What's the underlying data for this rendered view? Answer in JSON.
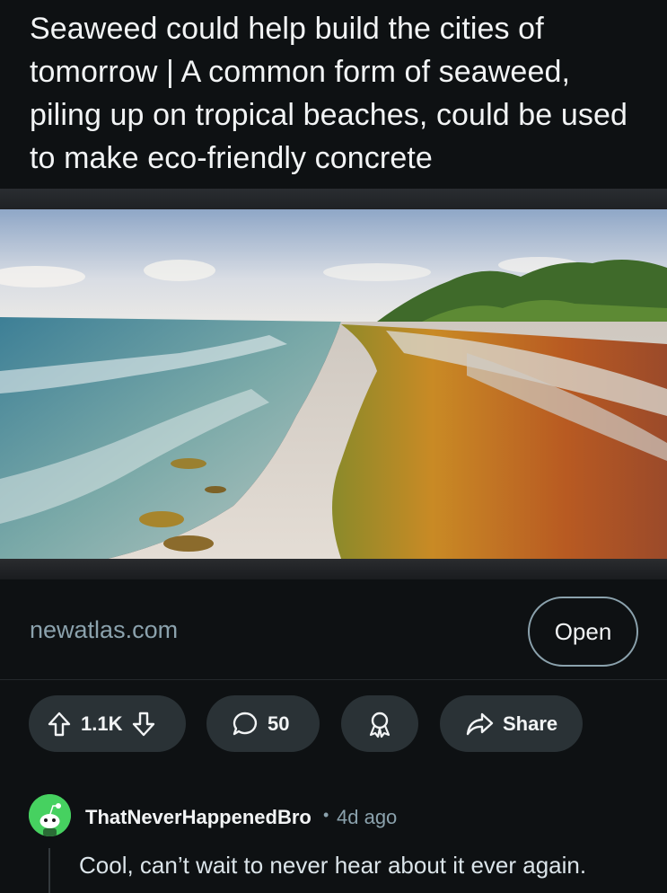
{
  "post": {
    "title": "Seaweed could help build the cities of tomorrow | A common form of seaweed, piling up on tropical beaches, could be used to make eco-friendly concrete",
    "image_icon": "beach-seaweed-photo"
  },
  "link": {
    "domain": "newatlas.com",
    "open_label": "Open"
  },
  "actions": {
    "vote_count": "1.1K",
    "comment_count": "50",
    "share_label": "Share",
    "icons": [
      "upvote-icon",
      "downvote-icon",
      "comment-icon",
      "award-icon",
      "share-icon"
    ]
  },
  "comment": {
    "username": "ThatNeverHappenedBro",
    "separator": "•",
    "time": "4d ago",
    "body": "Cool, can’t wait to never hear about it ever again."
  },
  "colors": {
    "background": "#0e1113",
    "pill": "#2a3236",
    "muted": "#8ba2ad",
    "avatar": "#46d160"
  }
}
